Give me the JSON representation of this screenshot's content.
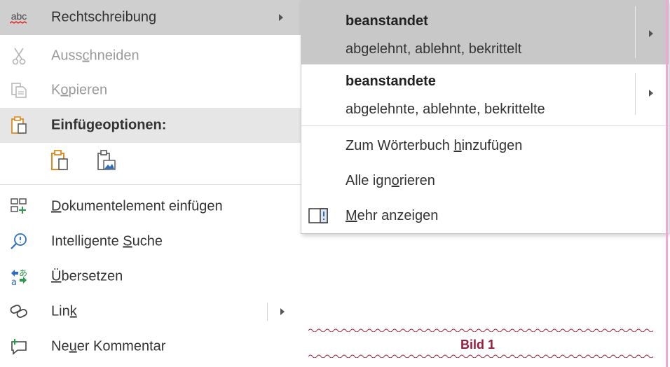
{
  "main_menu": {
    "spelling": "Rechtschreibung",
    "spelling_icon_text": "abc",
    "cut_pre": "Auss",
    "cut_u": "c",
    "cut_post": "hneiden",
    "copy_pre": "K",
    "copy_u": "o",
    "copy_post": "pieren",
    "paste_options": "Einfügeoptionen:",
    "insert_doc_pre": "",
    "insert_doc_u": "D",
    "insert_doc_post": "okumentelement einfügen",
    "smart_search_pre": "Intelligente ",
    "smart_search_u": "S",
    "smart_search_post": "uche",
    "translate_pre": "",
    "translate_u": "Ü",
    "translate_post": "bersetzen",
    "link_pre": "Lin",
    "link_u": "k",
    "link_post": "",
    "new_comment_pre": "Ne",
    "new_comment_u": "u",
    "new_comment_post": "er Kommentar"
  },
  "submenu": {
    "suggestions": [
      {
        "word": "beanstandet",
        "alternatives": "abgelehnt, ablehnt, bekrittelt"
      },
      {
        "word": "beanstandete",
        "alternatives": "abgelehnte, ablehnte, bekrittelte"
      }
    ],
    "add_dict_pre": "Zum Wörterbuch ",
    "add_dict_u": "h",
    "add_dict_post": "inzufügen",
    "ignore_pre": "Alle ign",
    "ignore_u": "o",
    "ignore_post": "rieren",
    "more_pre": "",
    "more_u": "M",
    "more_post": "ehr anzeigen"
  },
  "caption": "Bild 1",
  "colors": {
    "caption": "#9b1c3a",
    "squiggle": "#a0223a",
    "accent_orange": "#e08a1e",
    "link_blue": "#2b6cc4",
    "margin_pink": "#f1a8d8"
  }
}
